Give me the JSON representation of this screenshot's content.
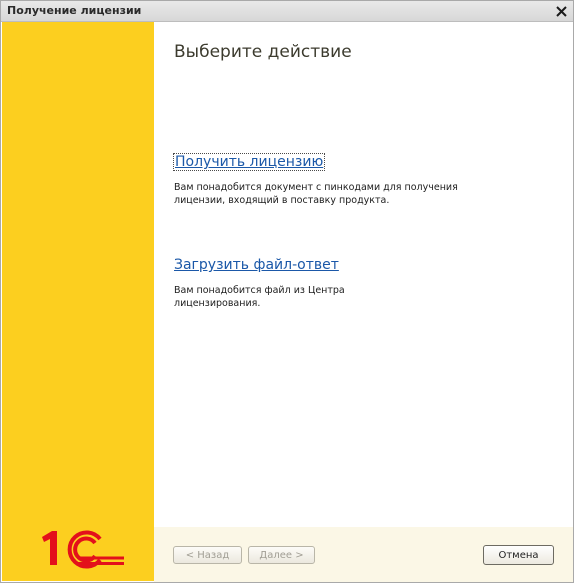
{
  "window": {
    "title": "Получение лицензии"
  },
  "main": {
    "heading": "Выберите действие",
    "actions": [
      {
        "label": "Получить лицензию",
        "description": "Вам понадобится документ с пинкодами для получения\nлицензии, входящий в поставку продукта."
      },
      {
        "label": "Загрузить файл-ответ",
        "description": "Вам понадобится файл из Центра\nлицензирования."
      }
    ]
  },
  "footer": {
    "back_label": "< Назад",
    "next_label": "Далее >",
    "cancel_label": "Отмена"
  },
  "colors": {
    "sidebar": "#fccf1f",
    "link": "#1b58a8",
    "logo_red": "#e3101b"
  },
  "logo": {
    "text": "1С"
  }
}
